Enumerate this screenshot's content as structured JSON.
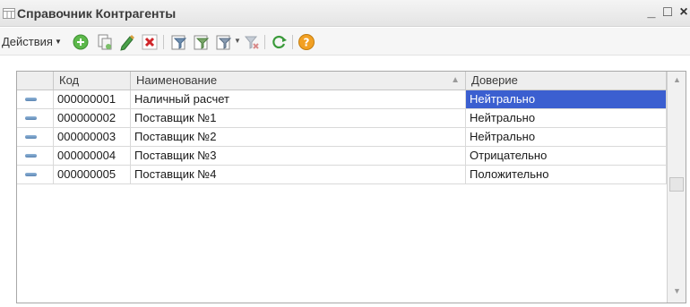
{
  "window": {
    "title": "Справочник Контрагенты",
    "minimize_label": "_",
    "maximize_label": "□",
    "close_label": "×"
  },
  "toolbar": {
    "actions_label": "Действия",
    "actions_arrow": "▼",
    "icons": [
      "add-icon",
      "copy-icon",
      "edit-icon",
      "delete-icon",
      "filter-icon",
      "filter-by-value-icon",
      "filter-history-icon",
      "clear-filter-icon",
      "refresh-icon",
      "help-icon"
    ]
  },
  "table": {
    "columns": [
      {
        "label": ""
      },
      {
        "label": "Код"
      },
      {
        "label": "Наименование"
      },
      {
        "label": "Доверие"
      }
    ],
    "sort_indicator": "▲",
    "rows": [
      {
        "code": "000000001",
        "name": "Наличный расчет",
        "trust": "Нейтрально",
        "selected": true
      },
      {
        "code": "000000002",
        "name": "Поставщик №1",
        "trust": "Нейтрально",
        "selected": false
      },
      {
        "code": "000000003",
        "name": "Поставщик №2",
        "trust": "Нейтрально",
        "selected": false
      },
      {
        "code": "000000004",
        "name": "Поставщик №3",
        "trust": "Отрицательно",
        "selected": false
      },
      {
        "code": "000000005",
        "name": "Поставщик №4",
        "trust": "Положительно",
        "selected": false
      }
    ]
  },
  "scrollbar": {
    "up_arrow": "▲",
    "down_arrow": "▼"
  },
  "colors": {
    "selection": "#3b5fd0",
    "row_marker": "#6d93bf"
  }
}
